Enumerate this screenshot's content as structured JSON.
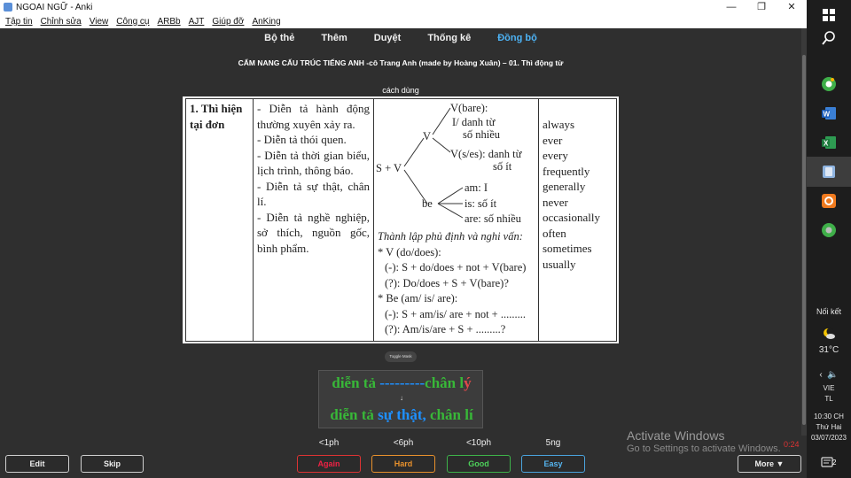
{
  "window": {
    "title": "NGOAI NGỮ - Anki",
    "minimize": "—",
    "maximize": "❐",
    "close": "✕"
  },
  "menu": [
    "Tập tin",
    "Chỉnh sửa",
    "View",
    "Công cụ",
    "ARBb",
    "AJT",
    "Giúp đỡ",
    "AnKing"
  ],
  "nav": {
    "decks": "Bộ thẻ",
    "add": "Thêm",
    "browse": "Duyệt",
    "stats": "Thống kê",
    "sync": "Đồng bộ"
  },
  "card": {
    "deck_title": "CẨM NANG CẤU TRÚC TIẾNG ANH -cô Trang Anh (made by Hoàng Xuân) – 01. Thì động từ",
    "usage_label": "cách dùng",
    "table": {
      "tense_name": "1. Thì hiện tại đơn",
      "usages": [
        "- Diễn tả hành động thường xuyên xảy ra.",
        "- Diễn tả thói quen.",
        "- Diễn tả thời gian biểu, lịch trình, thông báo.",
        "- Diễn tả sự thật, chân lí.",
        "- Diễn tả nghề nghiệp, sở thích, nguồn gốc, bình phẩm."
      ],
      "tree": {
        "root": "S + V",
        "v": "V",
        "be": "be",
        "v_bare": "V(bare):",
        "v_bare_note1": "I/ danh từ",
        "v_bare_note2": "số nhiều",
        "v_s": "V(s/es): danh từ",
        "v_s_note": "số ít",
        "am": "am: I",
        "is": "is: số ít",
        "are": "are: số nhiều"
      },
      "formulas": {
        "heading": "Thành lập phủ định và nghi vấn:",
        "v_head": "* V (do/does):",
        "v_neg": "(-): S + do/does + not + V(bare)",
        "v_q": "(?): Do/does + S + V(bare)?",
        "be_head": "* Be (am/ is/ are):",
        "be_neg": "(-): S + am/is/ are + not + .........",
        "be_q": "(?): Am/is/are + S + .........?"
      },
      "frequency": [
        "always",
        "ever",
        "every",
        "frequently",
        "generally",
        "never",
        "occasionally",
        "often",
        "sometimes",
        "usually"
      ]
    },
    "toggle_mask": "Toggle Mask",
    "answer": {
      "line1_prefix": "diễn tả ",
      "line1_blank": "---------",
      "line1_word": "chân l",
      "line1_end": "ý",
      "arrow": "↓",
      "line2_prefix": "diễn tả ",
      "line2_highlight": "sự thật,",
      "line2_end": " chân lí"
    }
  },
  "review": {
    "edit": "Edit",
    "skip": "Skip",
    "more": "More ▼",
    "buttons": [
      {
        "label": "Again",
        "time": "<1ph"
      },
      {
        "label": "Hard",
        "time": "<6ph"
      },
      {
        "label": "Good",
        "time": "<10ph"
      },
      {
        "label": "Easy",
        "time": "5ng"
      }
    ],
    "timer": "0:24"
  },
  "watermark": {
    "line1": "Activate Windows",
    "line2": "Go to Settings to activate Windows."
  },
  "taskbar": {
    "network_label": "Nối kết",
    "temperature": "31°C",
    "lang1": "VIE",
    "lang2": "TL",
    "time": "10:30 CH",
    "day": "Thứ Hai",
    "date": "03/07/2023",
    "notifications": "2"
  },
  "colors": {
    "sync_accent": "#4db3f5",
    "again": "#dd3333",
    "hard": "#e8912c",
    "good": "#3db34a",
    "easy": "#4aa3dd"
  }
}
